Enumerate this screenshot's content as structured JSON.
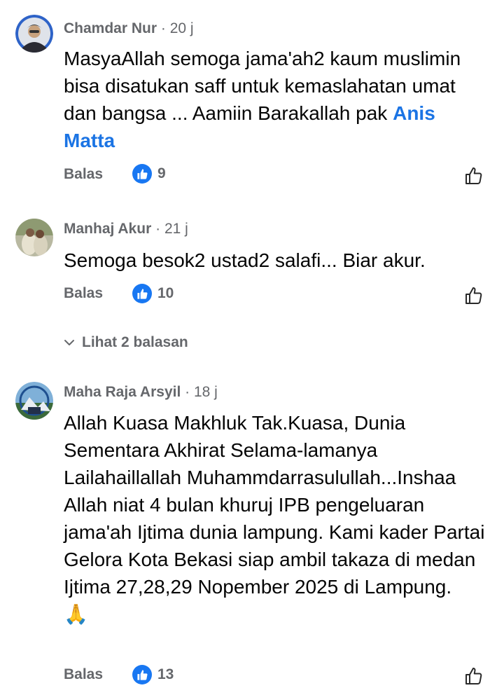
{
  "comments": [
    {
      "author": "Chamdar Nur",
      "time": "20 j",
      "text": "MasyaAllah semoga jama'ah2 kaum muslimin bisa disatukan saff untuk kemaslahatan umat dan bangsa ... Aamiin Barakallah pak ",
      "mention": "Anis Matta",
      "reply_label": "Balas",
      "like_count": "9"
    },
    {
      "author": "Manhaj Akur",
      "time": "21 j",
      "text": "Semoga besok2 ustad2 salafi... Biar akur.",
      "reply_label": "Balas",
      "like_count": "10",
      "view_replies_label": "Lihat 2 balasan"
    },
    {
      "author": "Maha Raja Arsyil",
      "time": "18 j",
      "text": "Allah Kuasa Makhluk Tak.Kuasa, Dunia Sementara Akhirat Selama-lamanya Lailahaillallah Muhammdarrasulullah...Inshaa Allah niat 4 bulan khuruj IPB pengeluaran jama'ah Ijtima dunia lampung. Kami kader Partai Gelora Kota Bekasi siap ambil takaza di medan Ijtima 27,28,29 Nopember 2025 di Lampung.",
      "emoji": "🙏",
      "reply_label": "Balas",
      "like_count": "13"
    }
  ],
  "separator": "·",
  "icons": {
    "like_reaction": "thumbs-up-icon",
    "like_action": "thumbs-up-outline-icon",
    "expand": "chevron-down-icon",
    "emoji": "folded-hands-icon"
  },
  "colors": {
    "accent": "#1877f2",
    "mention": "#1b74e4",
    "meta_text": "#65676b",
    "body_text": "#050505",
    "background": "#ffffff"
  }
}
